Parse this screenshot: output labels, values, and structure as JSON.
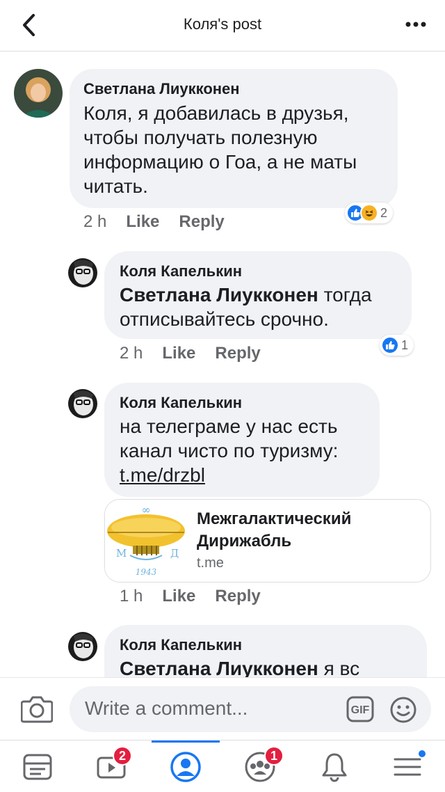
{
  "header": {
    "title": "Коля's post",
    "back_icon": "chevron-left-icon",
    "more_icon": "more-horizontal-icon"
  },
  "comments": [
    {
      "author": "Светлана Лиукконен",
      "text": "Коля, я добавилась в друзья, чтобы получать полезную информацию о Гоа, а не маты читать.",
      "time": "2 h",
      "like_label": "Like",
      "reply_label": "Reply",
      "reactions": [
        "like",
        "haha"
      ],
      "reaction_count": "2"
    },
    {
      "author": "Коля Капелькин",
      "mention": "Светлана Лиукконен",
      "text": " тогда отписывайтесь срочно.",
      "time": "2 h",
      "like_label": "Like",
      "reply_label": "Reply",
      "reactions": [
        "like"
      ],
      "reaction_count": "1"
    },
    {
      "author": "Коля Капелькин",
      "text": "на телеграме у нас есть канал чисто по туризму:",
      "link_text": "t.me/drzbl",
      "link_card": {
        "title": "Межгалактический Дирижабль",
        "domain": "t.me",
        "thumb_text_top": "∞",
        "thumb_text_left": "М",
        "thumb_text_right": "Д",
        "thumb_text_year": "1943"
      },
      "time": "1 h",
      "like_label": "Like",
      "reply_label": "Reply"
    },
    {
      "author": "Коля Капелькин",
      "mention": "Светлана Лиукконен",
      "text": " я вс"
    }
  ],
  "composer": {
    "placeholder": "Write a comment...",
    "gif_label": "GIF"
  },
  "bottom_nav": {
    "items": [
      {
        "icon": "news-feed-icon"
      },
      {
        "icon": "watch-video-icon",
        "badge": "2"
      },
      {
        "icon": "profile-icon",
        "active": true
      },
      {
        "icon": "groups-icon",
        "badge": "1"
      },
      {
        "icon": "notifications-bell-icon"
      },
      {
        "icon": "menu-icon",
        "dot": true
      }
    ]
  },
  "colors": {
    "accent": "#1877f2",
    "bubble": "#f0f2f5",
    "badge": "#e41e3f",
    "secondary_text": "#65676b"
  }
}
